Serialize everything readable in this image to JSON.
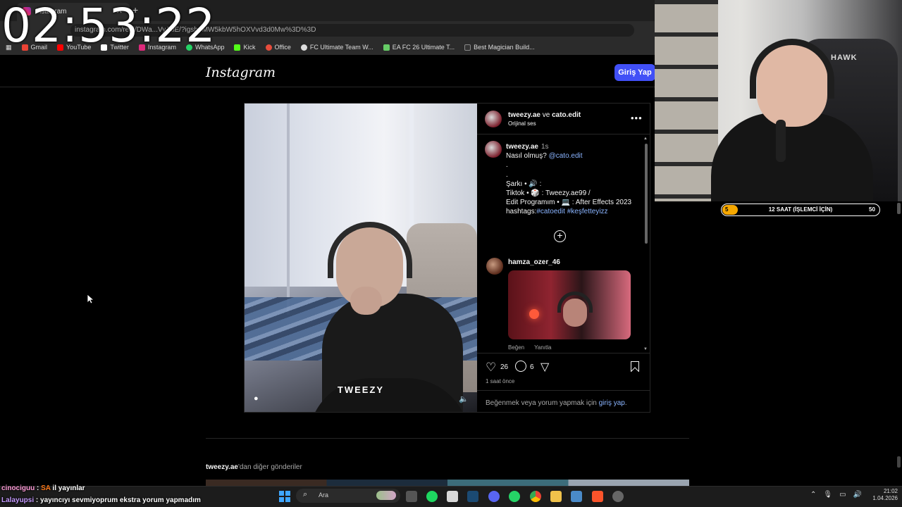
{
  "overlay": {
    "timer": "02:53:22",
    "chat": [
      {
        "user": "cinociguu",
        "sep": " : ",
        "prefix": "SA",
        "text": " il yayınlar"
      },
      {
        "user": "Lalayupsi",
        "sep": " : ",
        "text": "yayıncıyı sevmiyoprum ekstra yorum yapmadım"
      }
    ],
    "progress": {
      "start": "5",
      "label": "12 SAAT (İŞLEMCİ İÇİN)",
      "end": "50",
      "fraction": 0.1
    },
    "cam_brand": "HAWK"
  },
  "browser": {
    "tab_title": "Instagram",
    "url": "instagram.com/reel/DWa...VyJkiE/?igsh=MW5kbW5hOXVvd3d0Mw%3D%3D",
    "bookmarks": [
      "Gmail",
      "YouTube",
      "Twitter",
      "Instagram",
      "WhatsApp",
      "Kick",
      "Office",
      "FC Ultimate Team W...",
      "EA FC 26 Ultimate T...",
      "Best Magician Build..."
    ],
    "bookmark_colors": [
      "#ea4335",
      "#ff0000",
      "#ffffff",
      "#dd2a7b",
      "#25d366",
      "#53fc18",
      "#e74c3c",
      "#dddddd",
      "#66cc66",
      "#333333"
    ]
  },
  "instagram": {
    "logo": "Instagram",
    "login_button": "Giriş Yap",
    "post": {
      "video_caption": "TWEEZY",
      "author1": "tweezy.ae",
      "conjunction": " ve ",
      "author2": "cato.edit",
      "audio": "Orijinal ses",
      "caption": {
        "user": "tweezy.ae",
        "time": "1s",
        "line1_text": "Nasıl olmuş? ",
        "line1_mention": "@cato.edit",
        "dot1": ".",
        "dot2": ".",
        "line_song": "Şarkı • 🔊 :",
        "line_tiktok": "Tiktok • 🎲 : Tweezy.ae99 /",
        "line_edit": "Edit Programım • 💻 : After Effects 2023",
        "hashtags_label": "hashtags:",
        "hashtag1": "#catoedit",
        "hashtag2": " #keşfetteyizz"
      },
      "comment": {
        "user": "hamza_ozer_46",
        "like": "Beğen",
        "reply": "Yanıtla"
      },
      "likes": "26",
      "comments": "6",
      "time_ago": "1 saat önce",
      "login_prompt": "Beğenmek veya yorum yapmak için ",
      "login_link": "giriş yap",
      "login_end": "."
    },
    "more_posts_user": "tweezy.ae",
    "more_posts_text": "'dan diğer gönderiler"
  },
  "taskbar": {
    "search_placeholder": "Ara",
    "time": "21:02",
    "date": "1.04.2026"
  }
}
